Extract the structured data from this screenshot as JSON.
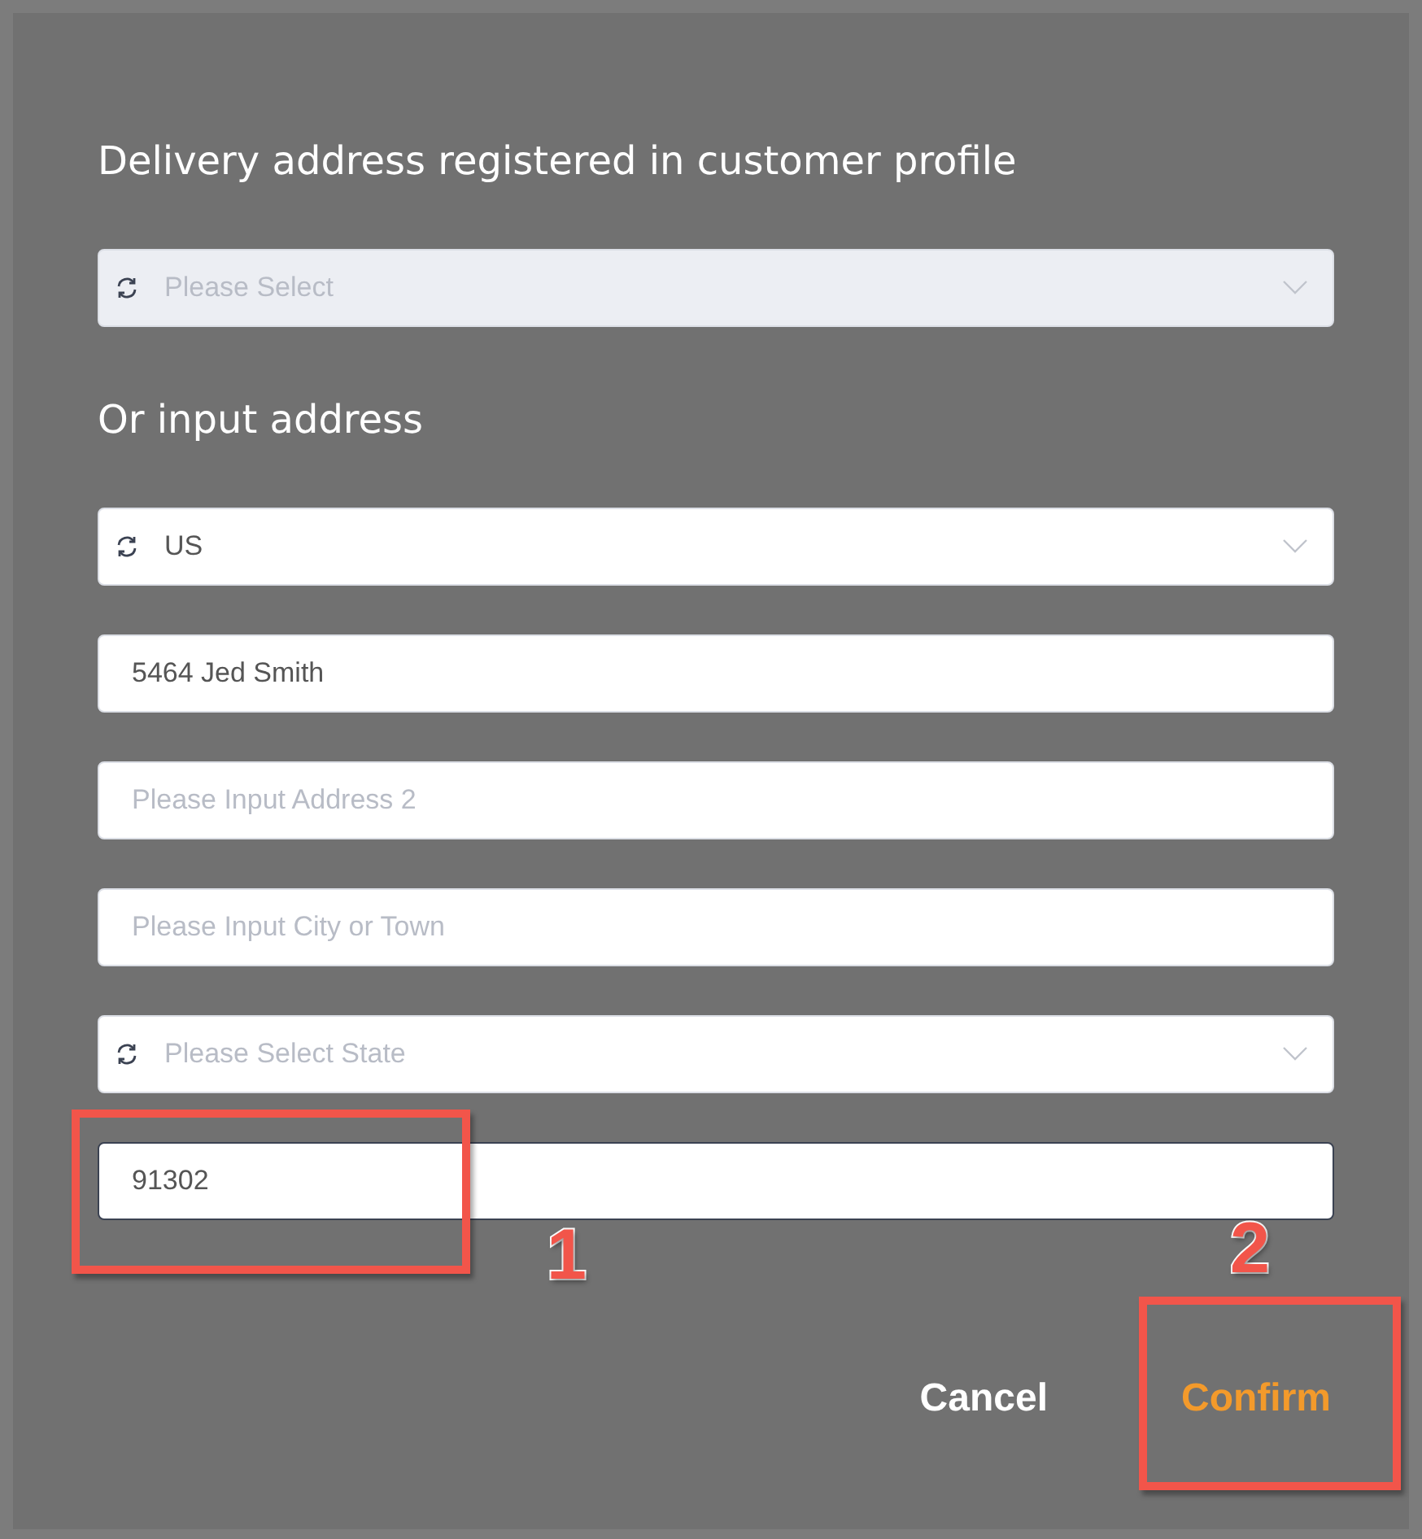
{
  "dialog": {
    "sections": [
      {
        "heading": "Delivery address registered in customer profile",
        "fields": [
          {
            "kind": "select",
            "placeholder": "Please Select",
            "disabled": true,
            "focused": false
          }
        ]
      },
      {
        "heading": "Or input address",
        "fields": [
          {
            "kind": "select",
            "value": "US",
            "disabled": false,
            "focused": false
          },
          {
            "kind": "input",
            "value": "5464 Jed Smith",
            "disabled": false,
            "focused": false
          },
          {
            "kind": "input",
            "placeholder": "Please Input Address 2",
            "disabled": false,
            "focused": false
          },
          {
            "kind": "input",
            "placeholder": "Please Input City or Town",
            "disabled": false,
            "focused": false
          },
          {
            "kind": "select",
            "placeholder": "Please Select State",
            "disabled": false,
            "focused": false
          },
          {
            "kind": "input",
            "value": "91302",
            "disabled": false,
            "focused": true
          }
        ]
      }
    ],
    "buttons": [
      {
        "label": "Cancel",
        "kind": "secondary"
      },
      {
        "label": "Confirm",
        "kind": "primary"
      }
    ]
  },
  "annotations": [
    {
      "label": "1"
    },
    {
      "label": "2"
    }
  ]
}
